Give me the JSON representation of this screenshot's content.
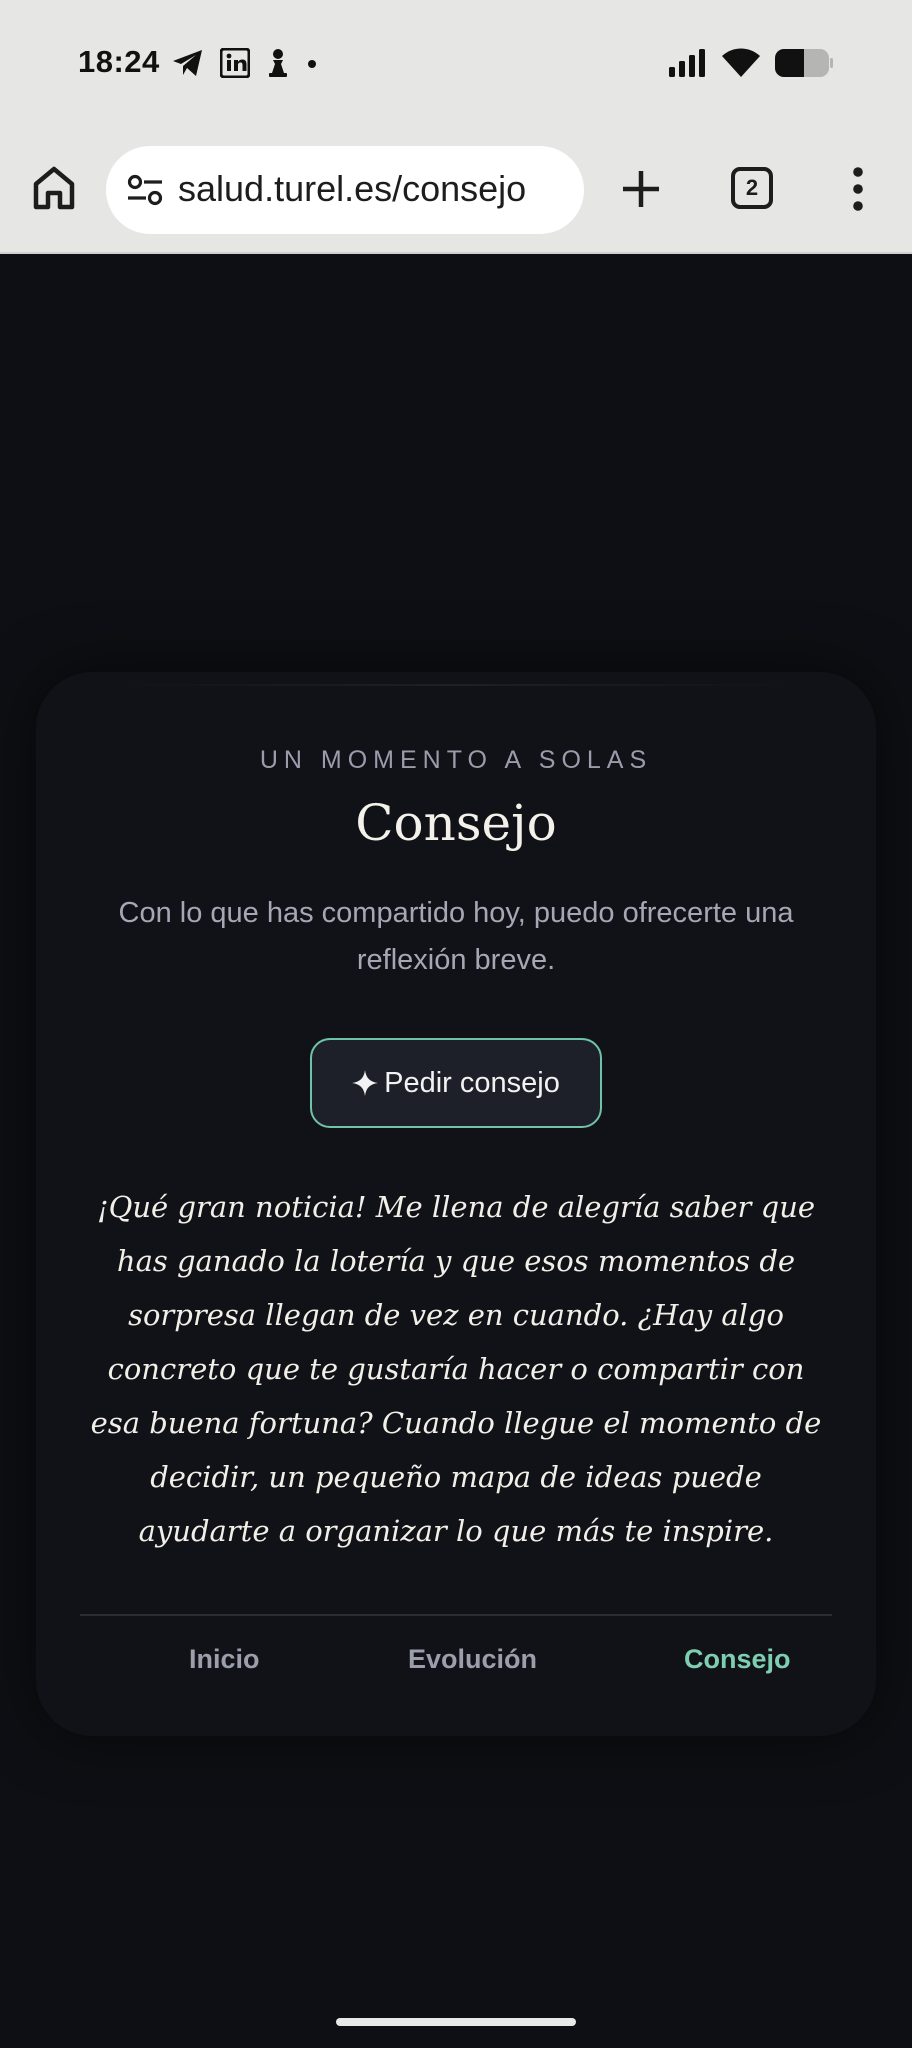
{
  "status_bar": {
    "time": "18:24",
    "left_icons": [
      "telegram-icon",
      "linkedin-icon",
      "chess-pawn-icon",
      "dot-icon"
    ],
    "right_icons": [
      "signal-icon",
      "wifi-icon",
      "battery-icon"
    ]
  },
  "browser": {
    "url": "salud.turel.es/consejo",
    "tab_count": "2"
  },
  "page": {
    "eyebrow": "UN MOMENTO A SOLAS",
    "title": "Consejo",
    "subtitle": "Con lo que has compartido hoy, puedo ofrecerte una reflexión breve.",
    "ask_button_label": "Pedir consejo",
    "advice_text": "¡Qué gran noticia! Me llena de alegría saber que has ganado la lotería y que esos momentos de sorpresa llegan de vez en cuando. ¿Hay algo concreto que te gustaría hacer o compartir con esa buena fortuna? Cuando llegue el momento de decidir, un pequeño mapa de ideas puede ayudarte a organizar lo que más te inspire."
  },
  "nav": {
    "items": [
      {
        "label": "Inicio",
        "active": false
      },
      {
        "label": "Evolución",
        "active": false
      },
      {
        "label": "Consejo",
        "active": true
      }
    ]
  },
  "colors": {
    "background": "#0e0f14",
    "card": "#111217",
    "accent": "#7ecfb2",
    "button_border": "#6fc4a8"
  }
}
